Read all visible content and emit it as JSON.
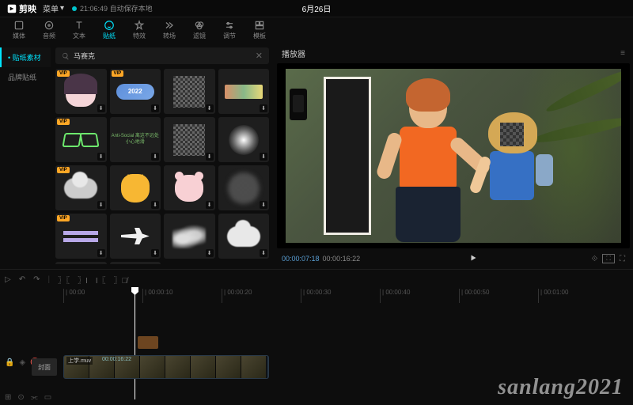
{
  "titlebar": {
    "logo": "剪映",
    "menu": "菜单",
    "save_status": "21:06:49 自动保存本地",
    "project": "6月26日"
  },
  "tabs": [
    {
      "id": "media",
      "label": "媒体"
    },
    {
      "id": "audio",
      "label": "音频"
    },
    {
      "id": "text",
      "label": "文本"
    },
    {
      "id": "sticker",
      "label": "贴纸"
    },
    {
      "id": "effect",
      "label": "特效"
    },
    {
      "id": "transition",
      "label": "转场"
    },
    {
      "id": "filter",
      "label": "滤镜"
    },
    {
      "id": "adjust",
      "label": "调节"
    },
    {
      "id": "template",
      "label": "模板"
    }
  ],
  "active_tab": "sticker",
  "side_nav": [
    {
      "id": "material",
      "label": "贴纸素材"
    },
    {
      "id": "brand",
      "label": "品牌贴纸"
    }
  ],
  "active_side": "material",
  "search": {
    "placeholder": "马赛克",
    "value": "马赛克"
  },
  "vip_badge": "VIP",
  "stickers": {
    "year": "2022",
    "text_sticker": "Anti-Social\n离这不远处\n小心地滑"
  },
  "preview": {
    "title": "播放器",
    "time_current": "00:00:07:18",
    "time_total": "00:00:16:22"
  },
  "timeline": {
    "ticks": [
      "00:00",
      "00:00:10",
      "00:00:20",
      "00:00:30",
      "00:00:40",
      "00:00:50",
      "00:01:00"
    ],
    "clip": {
      "name": "上学.muv",
      "duration": "00:00:16:22"
    },
    "cover_btn": "封面"
  },
  "watermark": "sanlang2021"
}
